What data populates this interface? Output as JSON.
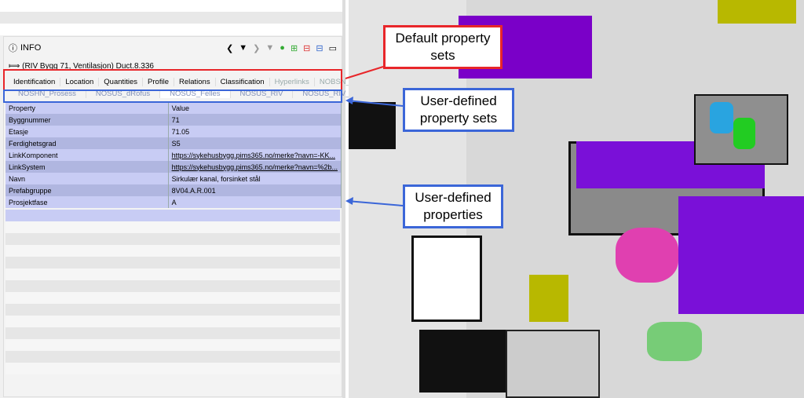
{
  "panel": {
    "title": "INFO",
    "object": "(RIV Bygg 71, Ventilasjon) Duct.8.336",
    "default_tabs": [
      "Identification",
      "Location",
      "Quantities",
      "Profile",
      "Relations",
      "Classification",
      "Hyperlinks",
      "NOBSN_TFM"
    ],
    "user_tabs": [
      "NOSHN_Prosess",
      "NOSUS_dRofus",
      "NOSUS_Felles",
      "NOSUS_RIV",
      "NOSUS_RIV_QA_Temp"
    ],
    "columns": [
      "Property",
      "Value"
    ],
    "rows": [
      [
        "Byggnummer",
        "71"
      ],
      [
        "Etasje",
        "71.05"
      ],
      [
        "Ferdighetsgrad",
        "S5"
      ],
      [
        "LinkKomponent",
        "https://sykehusbygg.pims365.no/merke?navn=-KK..."
      ],
      [
        "LinkSystem",
        "https://sykehusbygg.pims365.no/merke?navn=%2b..."
      ],
      [
        "Navn",
        "Sirkulær kanal, forsinket stål"
      ],
      [
        "Prefabgruppe",
        "8V04.A.R.001"
      ],
      [
        "Prosjektfase",
        "A"
      ]
    ]
  },
  "callouts": {
    "default": "Default property sets",
    "user_sets": "User-defined property sets",
    "user_props": "User-defined properties"
  },
  "colors": {
    "red": "#e8262a",
    "blue": "#3b66d8",
    "row": "#c8ccf4"
  }
}
